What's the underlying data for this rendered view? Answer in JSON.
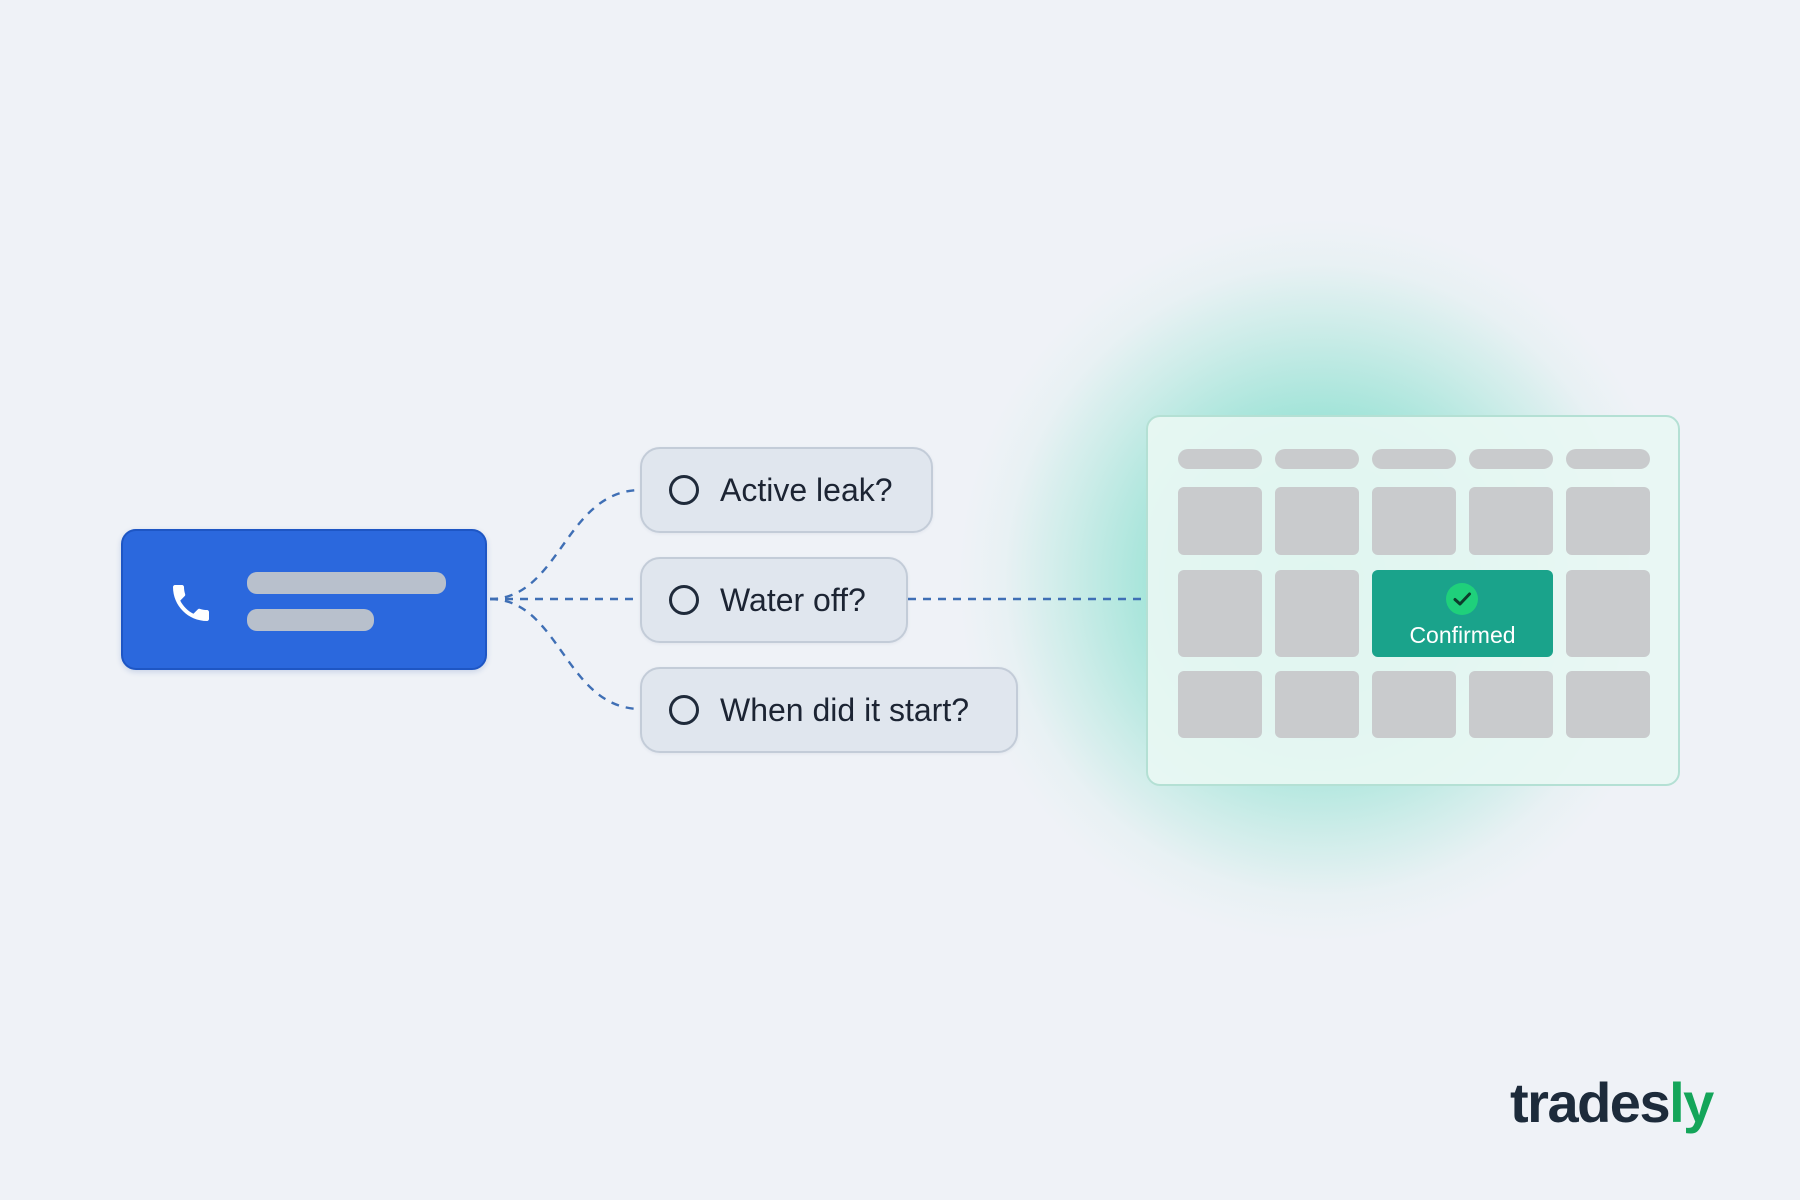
{
  "call": {
    "icon": "phone-icon"
  },
  "questions": [
    {
      "label": "Active leak?",
      "icon": "radio-empty-icon"
    },
    {
      "label": "Water off?",
      "icon": "radio-empty-icon"
    },
    {
      "label": "When did it start?",
      "icon": "radio-empty-icon"
    }
  ],
  "calendar": {
    "columns": 5,
    "rows": 3,
    "confirmed": {
      "label": "Confirmed",
      "icon": "check-circle-icon"
    }
  },
  "logo": {
    "part1": "trades",
    "part2": "ly"
  },
  "colors": {
    "background": "#eff2f7",
    "call_card": "#2b68dd",
    "connector": "#3f6fb5",
    "question_fill": "#e0e6ee",
    "confirmed": "#1aa38b",
    "check_badge": "#1fd07b",
    "glow": "#6ed7c3",
    "logo_dark": "#1d2b3b",
    "logo_green": "#14a55a"
  }
}
